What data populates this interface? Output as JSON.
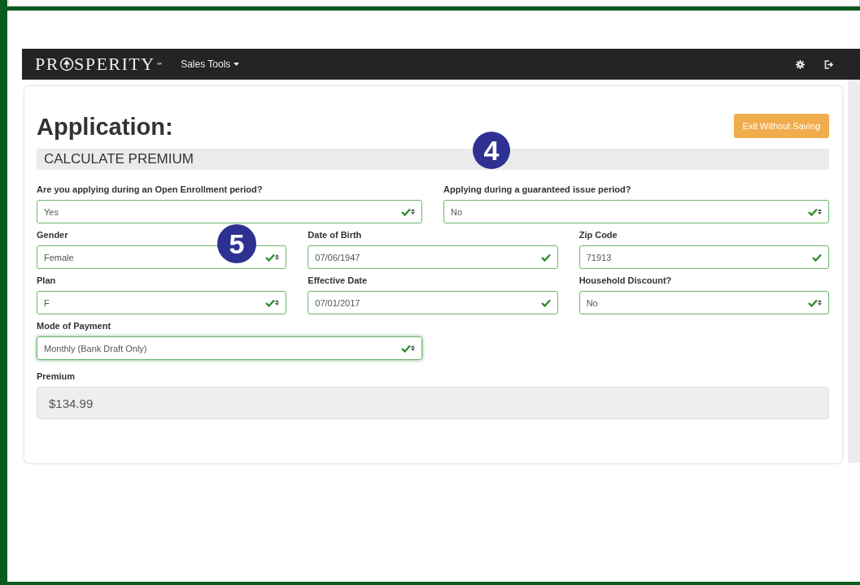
{
  "navbar": {
    "logo": {
      "before": "PR",
      "after": "SPERITY",
      "mark": "℠"
    },
    "menu": "Sales Tools"
  },
  "page": {
    "title": "Application:",
    "exit_button": "Exit Without Saving",
    "section": "CALCULATE PREMIUM"
  },
  "rows": [
    {
      "fields": [
        {
          "label": "Are you applying during an Open Enrollment period?",
          "value": "Yes",
          "kind": "select",
          "focused": false
        },
        {
          "label": "Applying during a guaranteed issue period?",
          "value": "No",
          "kind": "select",
          "focused": false
        }
      ]
    },
    {
      "fields": [
        {
          "label": "Gender",
          "value": "Female",
          "kind": "select",
          "focused": false
        },
        {
          "label": "Date of Birth",
          "value": "07/06/1947",
          "kind": "text",
          "focused": false
        },
        {
          "label": "Zip Code",
          "value": "71913",
          "kind": "text",
          "focused": false
        }
      ]
    },
    {
      "fields": [
        {
          "label": "Plan",
          "value": "F",
          "kind": "select",
          "focused": false
        },
        {
          "label": "Effective Date",
          "value": "07/01/2017",
          "kind": "text",
          "focused": false
        },
        {
          "label": "Household Discount?",
          "value": "No",
          "kind": "select",
          "focused": false
        }
      ]
    },
    {
      "fields": [
        {
          "label": "Mode of Payment",
          "value": "Monthly (Bank Draft Only)",
          "kind": "select",
          "focused": true
        }
      ]
    }
  ],
  "premium": {
    "label": "Premium",
    "value": "$134.99"
  },
  "callouts": [
    "4",
    "5"
  ]
}
